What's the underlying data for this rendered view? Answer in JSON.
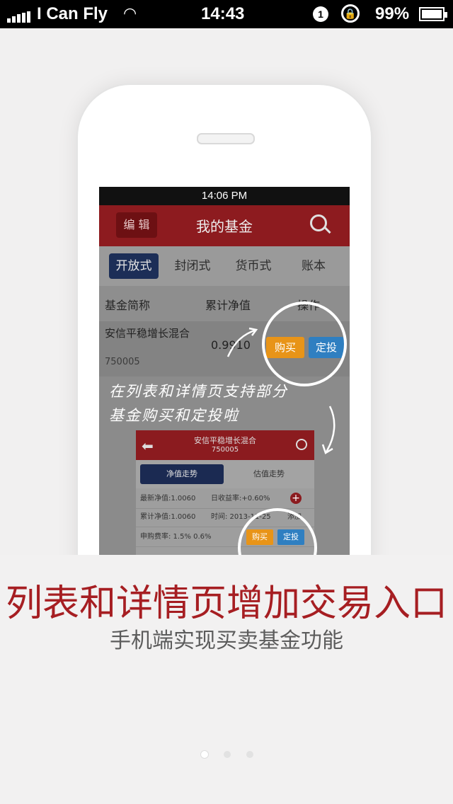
{
  "status_bar": {
    "carrier": "I Can Fly",
    "time": "14:43",
    "notification_count": "1",
    "battery_percent": "99%",
    "battery_level": 0.99
  },
  "inner_app": {
    "status_time": "14:06 PM",
    "nav": {
      "edit_label": "编 辑",
      "title": "我的基金"
    },
    "tabs": [
      {
        "label": "开放式",
        "active": true
      },
      {
        "label": "封闭式",
        "active": false
      },
      {
        "label": "货币式",
        "active": false
      },
      {
        "label": "账本",
        "active": false
      }
    ],
    "columns": [
      "基金简称",
      "累计净值",
      "操作"
    ],
    "row": {
      "name": "安信平稳增长混合",
      "code": "750005",
      "value": "0.9910",
      "buy_label": "购买",
      "auto_label": "定投"
    },
    "annotation_line1": "在列表和详情页支持部分",
    "annotation_line2": "基金购买和定投啦"
  },
  "detail_card": {
    "title": "安信平稳增长混合",
    "code": "750005",
    "tab_active": "净值走势",
    "tab_other": "估值走势",
    "rows": [
      {
        "left": "最新净值:1.0060",
        "right": "日收益率:+0.60%"
      },
      {
        "left": "累计净值:1.0060",
        "right": "时间: 2013-11-25"
      },
      {
        "left": "申购费率: 1.5%  0.6%",
        "right": ""
      }
    ],
    "add_label": "添加",
    "buy_label": "购买",
    "auto_label": "定投"
  },
  "headline": "列表和详情页增加交易入口",
  "subheadline": "手机端实现买卖基金功能",
  "pager": {
    "pages": 3,
    "current": 1
  },
  "colors": {
    "accent_red": "#a61e22",
    "buy_orange": "#e89418",
    "auto_blue": "#2f7fc1",
    "nav_dark_red": "#8d1b1f"
  }
}
